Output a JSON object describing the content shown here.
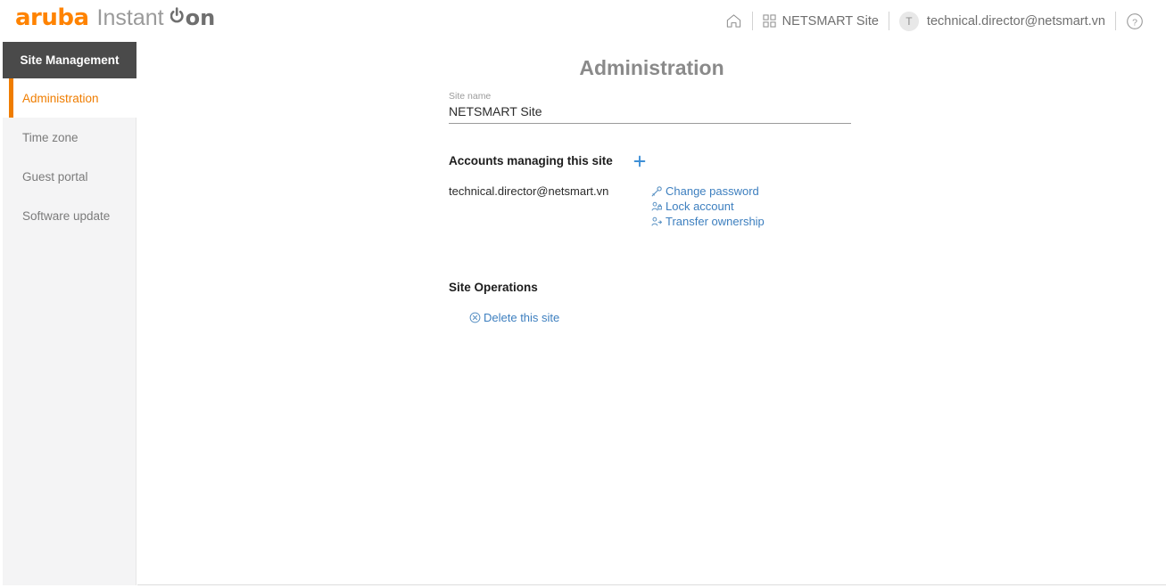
{
  "brand": {
    "name": "aruba",
    "product": "Instant",
    "suffix": "on"
  },
  "header": {
    "home_icon": "home-icon",
    "apps_icon": "grid-apps-icon",
    "site_name": "NETSMART Site",
    "avatar_initial": "T",
    "user_email": "technical.director@netsmart.vn",
    "help_icon": "question-circle-icon"
  },
  "sidebar": {
    "title": "Site Management",
    "items": [
      {
        "label": "Administration",
        "active": true
      },
      {
        "label": "Time zone",
        "active": false
      },
      {
        "label": "Guest portal",
        "active": false
      },
      {
        "label": "Software update",
        "active": false
      }
    ]
  },
  "main": {
    "page_title": "Administration",
    "site_name_field": {
      "label": "Site name",
      "value": "NETSMART Site",
      "placeholder": "Site name"
    },
    "accounts_section": {
      "heading": "Accounts managing this site",
      "add_label": "+",
      "account_email": "technical.director@netsmart.vn",
      "actions": [
        {
          "label": "Change password",
          "icon": "key-icon"
        },
        {
          "label": "Lock account",
          "icon": "person-lock-icon"
        },
        {
          "label": "Transfer ownership",
          "icon": "person-transfer-icon"
        }
      ]
    },
    "site_operations": {
      "heading": "Site Operations",
      "delete_label": "Delete this site",
      "delete_icon": "circle-x-icon"
    }
  },
  "colors": {
    "brand_orange": "#ff8300",
    "accent_blue": "#3d7fbf",
    "sidebar_dark": "#4a4a4a",
    "sidebar_bg": "#f4f4f5",
    "active_orange": "#ef7d00",
    "muted_text": "#8a8a8a"
  }
}
